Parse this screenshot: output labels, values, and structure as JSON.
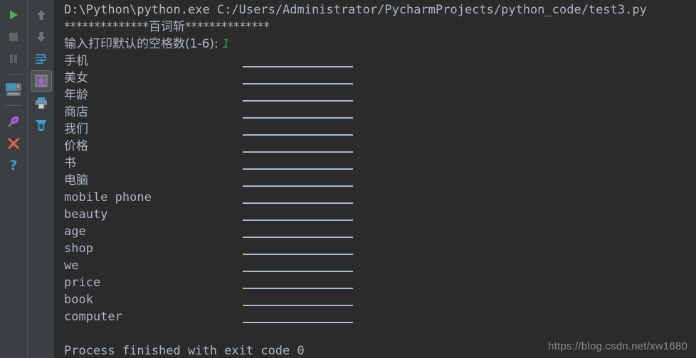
{
  "toolbars": {
    "run_column": [
      {
        "name": "run-button",
        "icon": "play-icon",
        "label": "Run"
      },
      {
        "name": "stop-button",
        "icon": "stop-icon",
        "label": "Stop"
      },
      {
        "name": "pause-button",
        "icon": "pause-icon",
        "label": "Pause Output"
      },
      {
        "name": "separator-1",
        "icon": "separator",
        "label": ""
      },
      {
        "name": "restore-layout-button",
        "icon": "layout-icon",
        "label": "Restore Layout"
      },
      {
        "name": "separator-2",
        "icon": "separator",
        "label": ""
      },
      {
        "name": "pin-tab-button",
        "icon": "pin-icon",
        "label": "Pin Tab"
      },
      {
        "name": "close-button",
        "icon": "close-x-icon",
        "label": "Close"
      },
      {
        "name": "help-button",
        "icon": "question-mark-icon",
        "label": "Help"
      }
    ],
    "console_column": [
      {
        "name": "up-button",
        "icon": "arrow-up-icon",
        "label": "Up the Stack Trace"
      },
      {
        "name": "down-button",
        "icon": "arrow-down-icon",
        "label": "Down the Stack Trace"
      },
      {
        "name": "soft-wrap-button",
        "icon": "soft-wrap-icon",
        "label": "Use Soft Wraps"
      },
      {
        "name": "scroll-to-end-button",
        "icon": "scroll-to-end-icon",
        "label": "Scroll to the end",
        "selected": true
      },
      {
        "name": "print-button",
        "icon": "printer-icon",
        "label": "Print"
      },
      {
        "name": "clear-all-button",
        "icon": "trash-icon",
        "label": "Clear All"
      }
    ]
  },
  "console": {
    "command_line": {
      "interpreter": "D:\\Python\\python.exe",
      "script": "C:/Users/Administrator/PycharmProjects/python_code/test3.py"
    },
    "banner": "**************百词斩**************",
    "prompt": {
      "text": "输入打印默认的空格数(1-6): ",
      "value": "1"
    },
    "word_lines": [
      {
        "word": "手机",
        "lang": "cn"
      },
      {
        "word": "美女",
        "lang": "cn"
      },
      {
        "word": "年龄",
        "lang": "cn"
      },
      {
        "word": "商店",
        "lang": "cn"
      },
      {
        "word": "我们",
        "lang": "cn"
      },
      {
        "word": "价格",
        "lang": "cn"
      },
      {
        "word": "书",
        "lang": "cn"
      },
      {
        "word": "电脑",
        "lang": "cn"
      },
      {
        "word": "mobile phone",
        "lang": "en"
      },
      {
        "word": "beauty",
        "lang": "en"
      },
      {
        "word": "age",
        "lang": "en"
      },
      {
        "word": "shop",
        "lang": "en"
      },
      {
        "word": "we",
        "lang": "en"
      },
      {
        "word": "price",
        "lang": "en"
      },
      {
        "word": "book",
        "lang": "en"
      },
      {
        "word": "computer",
        "lang": "en"
      }
    ],
    "exit_message": "Process finished with exit code 0"
  },
  "watermark": "https://blog.csdn.net/xw1680",
  "colors": {
    "background": "#2b2b2b",
    "toolbar_background": "#3c3f41",
    "text": "#a9b7c6",
    "input_value": "#24a148",
    "accent_blue": "#389fd6",
    "accent_purple": "#b05ce6",
    "close_red": "#e8604c",
    "run_green": "#4caf50"
  }
}
